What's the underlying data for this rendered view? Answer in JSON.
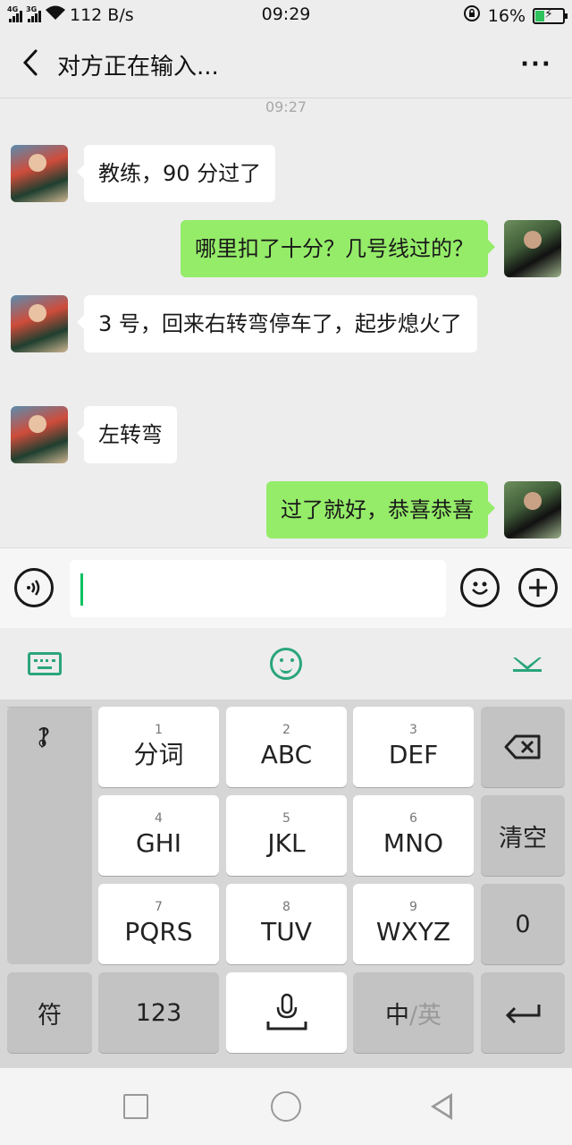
{
  "status_bar": {
    "network_1": "4G",
    "network_2": "3G",
    "speed": "112 B/s",
    "time": "09:29",
    "battery": "16%",
    "battery_level": 0.16
  },
  "header": {
    "title": "对方正在输入...",
    "more_label": "···"
  },
  "chat": {
    "timestamp": "09:27",
    "messages": [
      {
        "side": "left",
        "text": "教练，90 分过了"
      },
      {
        "side": "right",
        "text": "哪里扣了十分？几号线过的？"
      },
      {
        "side": "left",
        "text": "3 号，回来右转弯停车了，起步熄火了"
      },
      {
        "side": "left",
        "text": "左转弯"
      },
      {
        "side": "right",
        "text": "过了就好，恭喜恭喜"
      }
    ]
  },
  "input_bar": {
    "value": "",
    "icons": [
      "voice-icon",
      "emoji-icon",
      "plus-icon"
    ]
  },
  "keyboard_toolbar": {
    "icons": [
      "keyboard-icon",
      "smiley-icon",
      "hide-keyboard-icon"
    ]
  },
  "keyboard": {
    "punctuation": [
      "，",
      "。",
      "？",
      "！"
    ],
    "keys": [
      {
        "num": "1",
        "label": "分词"
      },
      {
        "num": "2",
        "label": "ABC"
      },
      {
        "num": "3",
        "label": "DEF"
      },
      {
        "num": "4",
        "label": "GHI"
      },
      {
        "num": "5",
        "label": "JKL"
      },
      {
        "num": "6",
        "label": "MNO"
      },
      {
        "num": "7",
        "label": "PQRS"
      },
      {
        "num": "8",
        "label": "TUV"
      },
      {
        "num": "9",
        "label": "WXYZ"
      }
    ],
    "clear_label": "清空",
    "zero_label": "0",
    "symbol_label": "符",
    "num_label": "123",
    "lang_primary": "中",
    "lang_separator": "/",
    "lang_secondary": "英"
  },
  "accent_color": "#2aa57c",
  "bubble_color_self": "#95ec69"
}
